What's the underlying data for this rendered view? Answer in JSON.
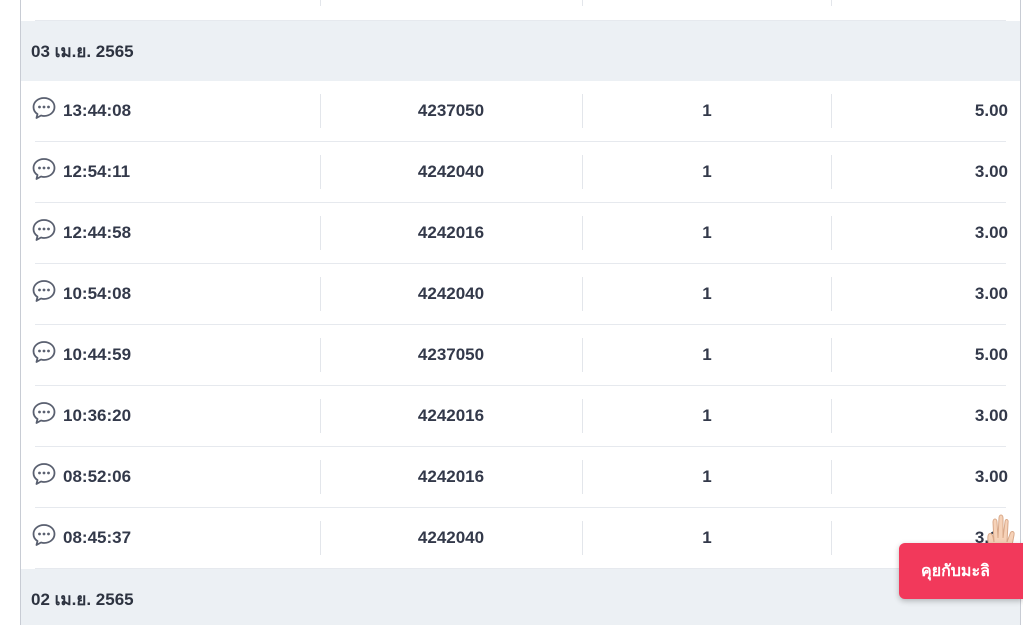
{
  "groups": [
    {
      "date": "03 เม.ย. 2565",
      "rows": [
        {
          "time": "13:44:08",
          "code": "4237050",
          "qty": "1",
          "amount": "5.00"
        },
        {
          "time": "12:54:11",
          "code": "4242040",
          "qty": "1",
          "amount": "3.00"
        },
        {
          "time": "12:44:58",
          "code": "4242016",
          "qty": "1",
          "amount": "3.00"
        },
        {
          "time": "10:54:08",
          "code": "4242040",
          "qty": "1",
          "amount": "3.00"
        },
        {
          "time": "10:44:59",
          "code": "4237050",
          "qty": "1",
          "amount": "5.00"
        },
        {
          "time": "10:36:20",
          "code": "4242016",
          "qty": "1",
          "amount": "3.00"
        },
        {
          "time": "08:52:06",
          "code": "4242016",
          "qty": "1",
          "amount": "3.00"
        },
        {
          "time": "08:45:37",
          "code": "4242040",
          "qty": "1",
          "amount": "3.00"
        }
      ]
    },
    {
      "date": "02 เม.ย. 2565",
      "rows": []
    }
  ],
  "chat_widget": {
    "label": "คุยกับมะลิ",
    "icon": "waving-hand-icon",
    "color": "#f2395b"
  },
  "row_icon": "chat-bubble-icon"
}
